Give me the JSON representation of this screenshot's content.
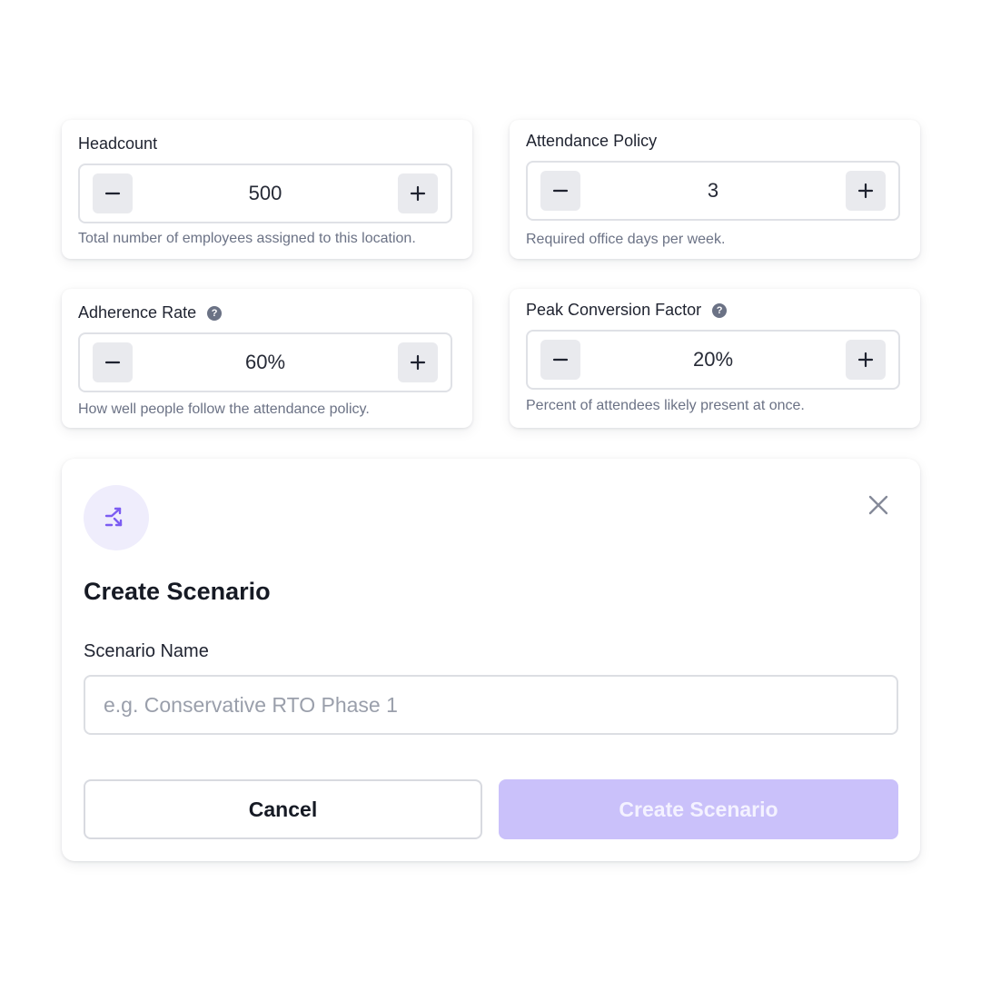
{
  "fields": [
    {
      "label": "Headcount",
      "value": "500",
      "helper": "Total number of employees assigned to this location."
    },
    {
      "label": "Attendance Policy",
      "value": "3",
      "helper": "Required office days per week."
    },
    {
      "label": "Adherence Rate",
      "value": "60%",
      "helper": "How well people follow the attendance policy."
    },
    {
      "label": "Peak Conversion Factor",
      "value": "20%",
      "helper": "Percent of attendees likely present at once."
    }
  ],
  "help_glyph": "?",
  "modal": {
    "icon": "shuffle-icon",
    "title": "Create Scenario",
    "name_label": "Scenario Name",
    "name_value": "",
    "name_placeholder": "e.g. Conservative RTO Phase 1",
    "cancel_label": "Cancel",
    "create_label": "Create Scenario",
    "create_enabled": false
  },
  "colors": {
    "accent": "#7c5cf2",
    "accent_disabled": "#cac1fa",
    "icon_bg": "#efedfc",
    "muted_text": "#6b7285"
  }
}
